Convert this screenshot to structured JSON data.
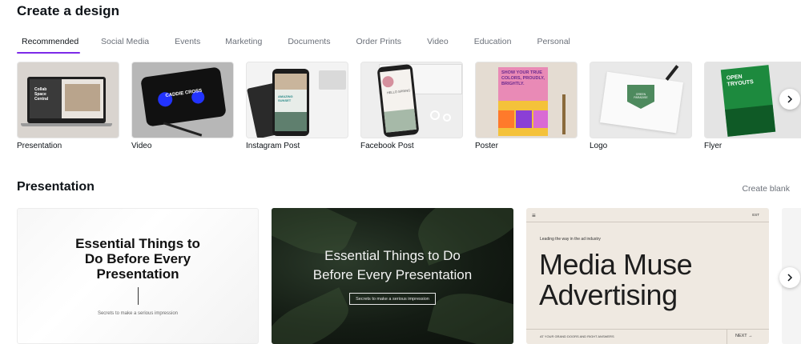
{
  "page": {
    "title": "Create a design"
  },
  "tabs": [
    {
      "label": "Recommended"
    },
    {
      "label": "Social Media"
    },
    {
      "label": "Events"
    },
    {
      "label": "Marketing"
    },
    {
      "label": "Documents"
    },
    {
      "label": "Order Prints"
    },
    {
      "label": "Video"
    },
    {
      "label": "Education"
    },
    {
      "label": "Personal"
    }
  ],
  "categories": [
    {
      "label": "Presentation",
      "thumb_text": "Collab Space Central"
    },
    {
      "label": "Video",
      "thumb_text": "CADDIE CROSS"
    },
    {
      "label": "Instagram Post",
      "thumb_text": "AMAZING SUNSET"
    },
    {
      "label": "Facebook Post",
      "thumb_text": "HELLO SPRING"
    },
    {
      "label": "Poster",
      "thumb_text": "SHOW YOUR TRUE COLORS, PROUDLY, BRIGHTLY."
    },
    {
      "label": "Logo",
      "thumb_text": "GREEN PARADISE"
    },
    {
      "label": "Flyer",
      "thumb_text": "OPEN TRYOUTS"
    }
  ],
  "section": {
    "title": "Presentation",
    "create_blank": "Create blank"
  },
  "templates": [
    {
      "heading_lines": [
        "Essential Things to",
        "Do Before Every",
        "Presentation"
      ],
      "subtitle": "Secrets to make a serious impression"
    },
    {
      "heading_lines": [
        "Essential Things to Do",
        "Before Every Presentation"
      ],
      "button": "Secrets to make a serious impression"
    },
    {
      "menu": "≡",
      "est": "EST",
      "kicker": "Leading the way in the ad industry",
      "heading_lines": [
        "Media Muse",
        "Advertising"
      ],
      "footer": "AT YOUR GRAND DOORS AND RIGHT ANSWERS",
      "next": "NEXT →"
    }
  ],
  "colors": {
    "accent": "#7d2ae8",
    "text": "#0e1318",
    "muted": "#6b7079"
  },
  "icons": {
    "next_arrow": "chevron-right-icon"
  }
}
